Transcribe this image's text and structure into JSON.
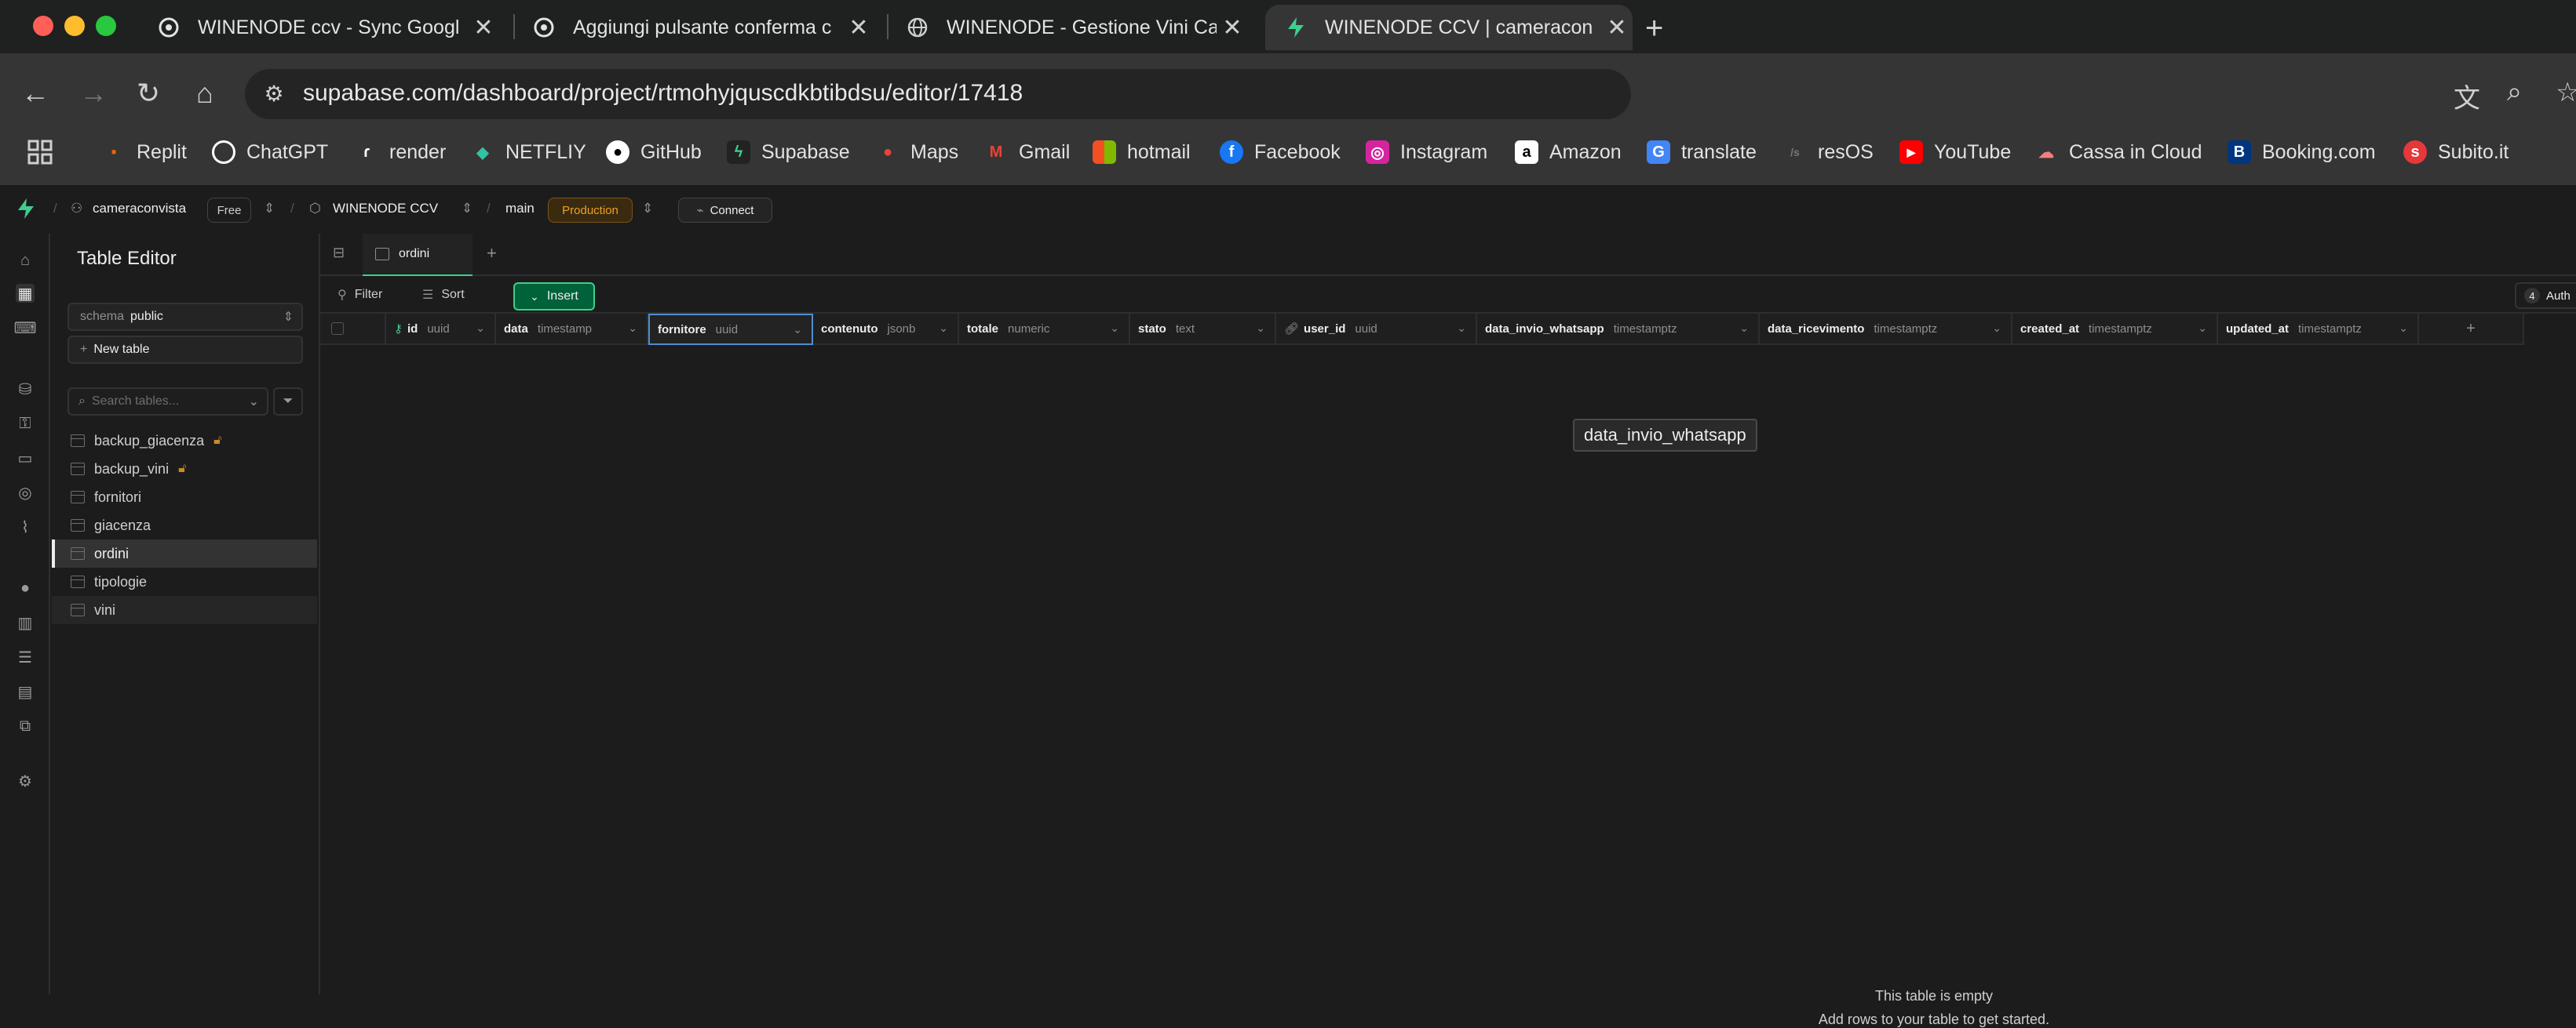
{
  "browser": {
    "tabs": [
      {
        "title": "WINENODE ccv - Sync Googl",
        "active": false
      },
      {
        "title": "Aggiungi pulsante conferma c",
        "active": false
      },
      {
        "title": "WINENODE - Gestione Vini Ca",
        "active": false
      },
      {
        "title": "WINENODE CCV | cameracon",
        "active": true
      }
    ],
    "url": "supabase.com/dashboard/project/rtmohyjquscdkbtibdsu/editor/17418",
    "bookmarks": [
      "Replit",
      "ChatGPT",
      "render",
      "NETFLIY",
      "GitHub",
      "Supabase",
      "Maps",
      "Gmail",
      "hotmail",
      "Facebook",
      "Instagram",
      "Amazon",
      "translate",
      "resOS",
      "YouTube",
      "Cassa in Cloud",
      "Booking.com",
      "Subito.it"
    ]
  },
  "topbar": {
    "org": "cameraconvista",
    "plan": "Free",
    "project": "WINENODE CCV",
    "branch": "main",
    "env": "Production",
    "connect": "Connect",
    "auth_count": "4",
    "auth_label": "Auth"
  },
  "sidebar": {
    "title": "Table Editor",
    "schema_label": "schema",
    "schema_value": "public",
    "new_table": "New table",
    "search_placeholder": "Search tables...",
    "tables": [
      {
        "name": "backup_giacenza",
        "locked": true
      },
      {
        "name": "backup_vini",
        "locked": true
      },
      {
        "name": "fornitori",
        "locked": false
      },
      {
        "name": "giacenza",
        "locked": false
      },
      {
        "name": "ordini",
        "locked": false,
        "selected": true
      },
      {
        "name": "tipologie",
        "locked": false
      },
      {
        "name": "vini",
        "locked": false
      }
    ]
  },
  "editor": {
    "tab": "ordini",
    "filter": "Filter",
    "sort": "Sort",
    "insert": "Insert",
    "columns": [
      {
        "name": "id",
        "type": "uuid"
      },
      {
        "name": "data",
        "type": "timestamp"
      },
      {
        "name": "fornitore",
        "type": "uuid"
      },
      {
        "name": "contenuto",
        "type": "jsonb"
      },
      {
        "name": "totale",
        "type": "numeric"
      },
      {
        "name": "stato",
        "type": "text"
      },
      {
        "name": "user_id",
        "type": "uuid"
      },
      {
        "name": "data_invio_whatsapp",
        "type": "timestamptz"
      },
      {
        "name": "data_ricevimento",
        "type": "timestamptz"
      },
      {
        "name": "created_at",
        "type": "timestamptz"
      },
      {
        "name": "updated_at",
        "type": "timestamptz"
      }
    ],
    "tooltip": "data_invio_whatsapp",
    "empty_title": "This table is empty",
    "empty_sub": "Add rows to your table to get started."
  },
  "colors": {
    "accent": "#3ecf8e",
    "warning": "#c98a28",
    "bg": "#1c1c1c"
  }
}
